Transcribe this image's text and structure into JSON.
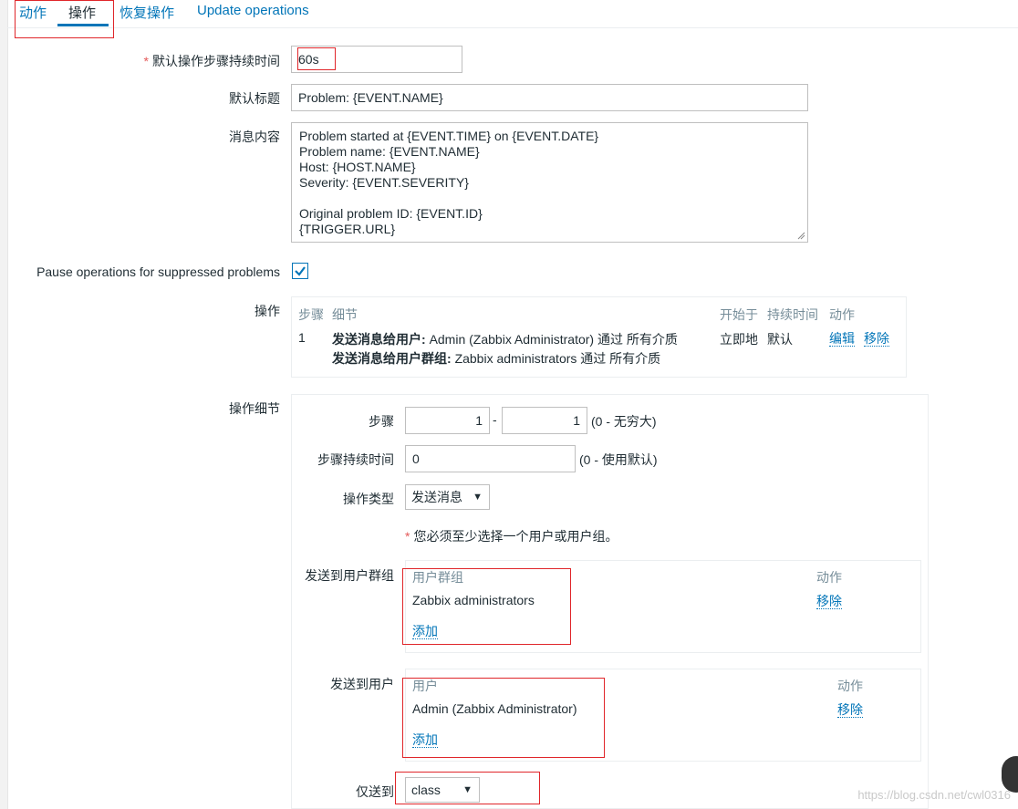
{
  "tabs": [
    {
      "label": "动作"
    },
    {
      "label": "操作"
    },
    {
      "label": "恢复操作"
    },
    {
      "label": "Update operations"
    }
  ],
  "form": {
    "step_duration": {
      "label": "默认操作步骤持续时间",
      "value": "60s"
    },
    "default_subject": {
      "label": "默认标题",
      "value": "Problem: {EVENT.NAME}"
    },
    "default_message": {
      "label": "消息内容",
      "lines": [
        "Problem started at {EVENT.TIME} on {EVENT.DATE}",
        "Problem name: {EVENT.NAME}",
        "Host: {HOST.NAME}",
        "Severity: {EVENT.SEVERITY}",
        "",
        "Original problem ID: {EVENT.ID}",
        "{TRIGGER.URL}"
      ]
    },
    "pause_suppressed": {
      "label": "Pause operations for suppressed problems",
      "checked": true
    }
  },
  "operations": {
    "label": "操作",
    "headers": {
      "steps": "步骤",
      "details": "细节",
      "start_in": "开始于",
      "duration": "持续时间",
      "action": "动作"
    },
    "rows": [
      {
        "step": "1",
        "detail_user_prefix": "发送消息给用户:",
        "detail_user_text": "Admin (Zabbix Administrator) 通过 所有介质",
        "detail_group_prefix": "发送消息给用户群组:",
        "detail_group_text": "Zabbix administrators 通过 所有介质",
        "start_in": "立即地",
        "duration": "默认",
        "edit": "编辑",
        "remove": "移除"
      }
    ]
  },
  "operation_details": {
    "label": "操作细节",
    "steps": {
      "label": "步骤",
      "from": "1",
      "separator": "-",
      "to": "1",
      "hint": "(0 - 无穷大)"
    },
    "step_duration": {
      "label": "步骤持续时间",
      "value": "0",
      "hint": "(0 - 使用默认)"
    },
    "operation_type": {
      "label": "操作类型",
      "value": "发送消息"
    },
    "required_notice": "您必须至少选择一个用户或用户组。",
    "user_groups": {
      "label": "发送到用户群组",
      "col_name": "用户群组",
      "col_action": "动作",
      "items": [
        {
          "name": "Zabbix administrators",
          "remove": "移除"
        }
      ],
      "add": "添加"
    },
    "users": {
      "label": "发送到用户",
      "col_name": "用户",
      "col_action": "动作",
      "items": [
        {
          "name": "Admin (Zabbix Administrator)",
          "remove": "移除"
        }
      ],
      "add": "添加"
    },
    "send_only_to": {
      "label": "仅送到",
      "value": "class"
    }
  },
  "watermark": "https://blog.csdn.net/cwl0316",
  "colors": {
    "link": "#0275b8",
    "annotation_red": "#e0262a",
    "required": "#e45959"
  }
}
